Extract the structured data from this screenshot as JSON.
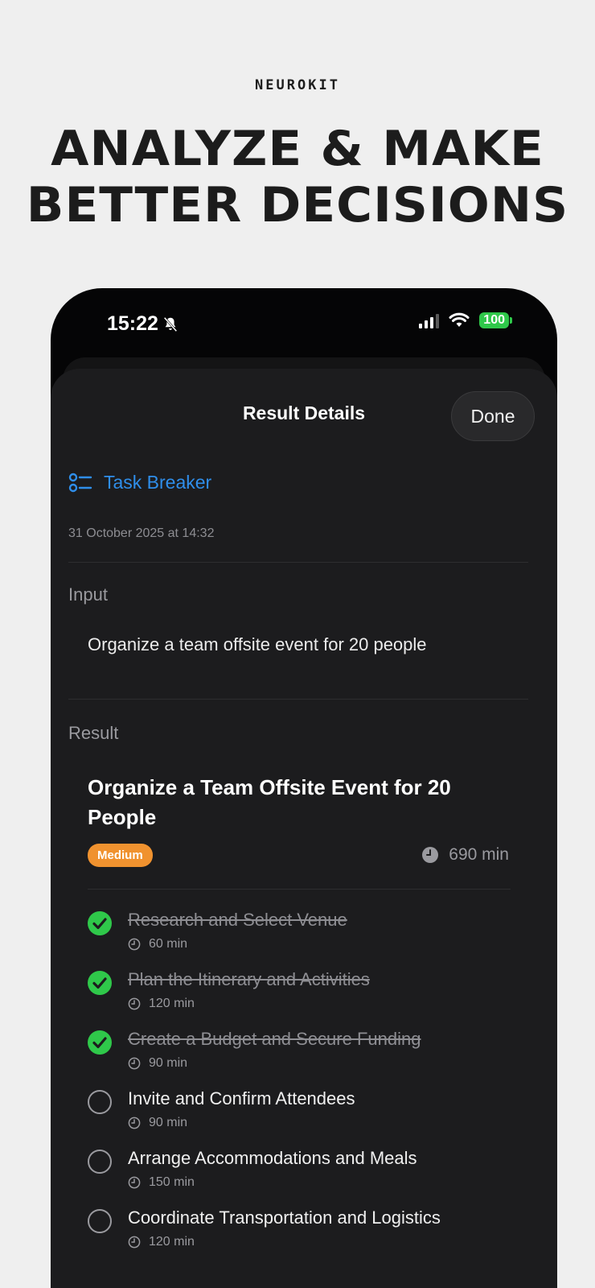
{
  "header": {
    "brand": "NEUROKIT",
    "headline_line1": "ANALYZE & MAKE",
    "headline_line2": "BETTER DECISIONS"
  },
  "status_bar": {
    "time": "15:22",
    "battery": "100",
    "accent_battery": "#2fc84a"
  },
  "sheet": {
    "title": "Result Details",
    "done_label": "Done"
  },
  "tool": {
    "icon": "list-checks-icon",
    "label": "Task Breaker",
    "timestamp": "31 October 2025 at 14:32",
    "accent": "#2f8eea"
  },
  "input": {
    "label": "Input",
    "text": "Organize a team offsite event for 20 people"
  },
  "result": {
    "label": "Result",
    "title": "Organize a Team Offsite Event for 20 People",
    "priority": "Medium",
    "priority_color": "#f0922f",
    "total_time": "690 min",
    "tasks": [
      {
        "name": "Research and Select Venue",
        "duration": "60 min",
        "completed": true
      },
      {
        "name": "Plan the Itinerary and Activities",
        "duration": "120 min",
        "completed": true
      },
      {
        "name": "Create a Budget and Secure Funding",
        "duration": "90 min",
        "completed": true
      },
      {
        "name": "Invite and Confirm Attendees",
        "duration": "90 min",
        "completed": false
      },
      {
        "name": "Arrange Accommodations and Meals",
        "duration": "150 min",
        "completed": false
      },
      {
        "name": "Coordinate Transportation and Logistics",
        "duration": "120 min",
        "completed": false
      }
    ]
  }
}
